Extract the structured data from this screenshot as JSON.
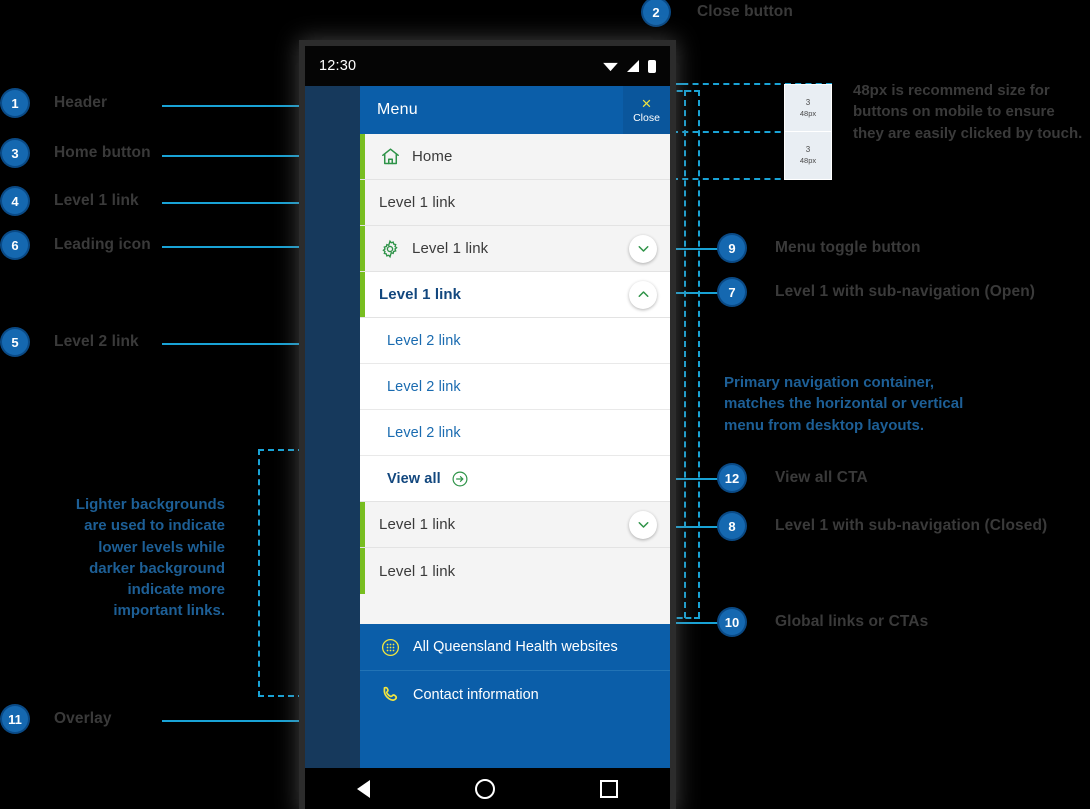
{
  "phone": {
    "status": {
      "time": "12:30",
      "icons": [
        "wifi-icon",
        "signal-icon",
        "battery-icon"
      ]
    },
    "drawer": {
      "title": "Menu",
      "close": {
        "glyph": "×",
        "label": "Close"
      },
      "items": [
        {
          "id": "home",
          "label": "Home",
          "level": 1,
          "icon": "home-icon",
          "state": "default"
        },
        {
          "id": "l1-a",
          "label": "Level 1 link",
          "level": 1,
          "icon": null,
          "state": "default"
        },
        {
          "id": "l1-b",
          "label": "Level 1 link",
          "level": 1,
          "icon": "gear-icon",
          "state": "collapsed"
        },
        {
          "id": "l1-open",
          "label": "Level 1 link",
          "level": 1,
          "icon": null,
          "state": "expanded"
        },
        {
          "id": "l2-a",
          "label": "Level 2 link",
          "level": 2,
          "icon": null,
          "state": "default"
        },
        {
          "id": "l2-b",
          "label": "Level 2 link",
          "level": 2,
          "icon": null,
          "state": "default"
        },
        {
          "id": "l2-c",
          "label": "Level 2 link",
          "level": 2,
          "icon": null,
          "state": "default"
        },
        {
          "id": "view-all",
          "label": "View all",
          "level": 2,
          "icon": "arrow-right-circle-icon",
          "state": "cta"
        },
        {
          "id": "l1-c",
          "label": "Level 1 link",
          "level": 1,
          "icon": null,
          "state": "collapsed"
        },
        {
          "id": "l1-d",
          "label": "Level 1 link",
          "level": 1,
          "icon": null,
          "state": "default"
        }
      ],
      "global_links": [
        {
          "id": "all-sites",
          "label": "All Queensland Health websites",
          "icon": "grid-circle-icon"
        },
        {
          "id": "contact",
          "label": "Contact information",
          "icon": "phone-icon"
        }
      ]
    },
    "navbar": [
      "back-icon",
      "home-icon",
      "recents-icon"
    ]
  },
  "annotations": {
    "left": [
      {
        "num": "1",
        "label": "Header"
      },
      {
        "num": "3",
        "label": "Home button"
      },
      {
        "num": "4",
        "label": "Level 1 link"
      },
      {
        "num": "6",
        "label": "Leading icon"
      },
      {
        "num": "5",
        "label": "Level 2 link"
      },
      {
        "num": "11",
        "label": "Overlay"
      }
    ],
    "right": [
      {
        "num": "2",
        "label": "Close button"
      },
      {
        "num": "9",
        "label": "Menu toggle button"
      },
      {
        "num": "7",
        "label": "Level 1 with sub-navigation (Open)"
      },
      {
        "num": "12",
        "label": "View all CTA"
      },
      {
        "num": "8",
        "label": "Level 1 with sub-navigation (Closed)"
      },
      {
        "num": "10",
        "label": "Global links or CTAs"
      }
    ],
    "notes": {
      "touch_target": "48px is recommend size for\nbuttons on mobile to ensure\nthey are easily clicked by touch.",
      "primary_container": "Primary navigation container,\nmatches the horizontal or vertical\nmenu from desktop layouts.",
      "backgrounds": "Lighter backgrounds\nare used to indicate\nlower levels while\ndarker background\nindicate more\nimportant links."
    },
    "measures": [
      {
        "num": "3",
        "value": "48px"
      },
      {
        "num": "3",
        "value": "48px"
      }
    ]
  },
  "colors": {
    "header_blue": "#0b5ea9",
    "overlay_navy": "#16395c",
    "accent_green": "#78be20",
    "link_blue": "#1a6bb0",
    "annotation_cyan": "#19a3d6",
    "badge_blue": "#1568b0",
    "cta_yellow": "#f2e640"
  }
}
